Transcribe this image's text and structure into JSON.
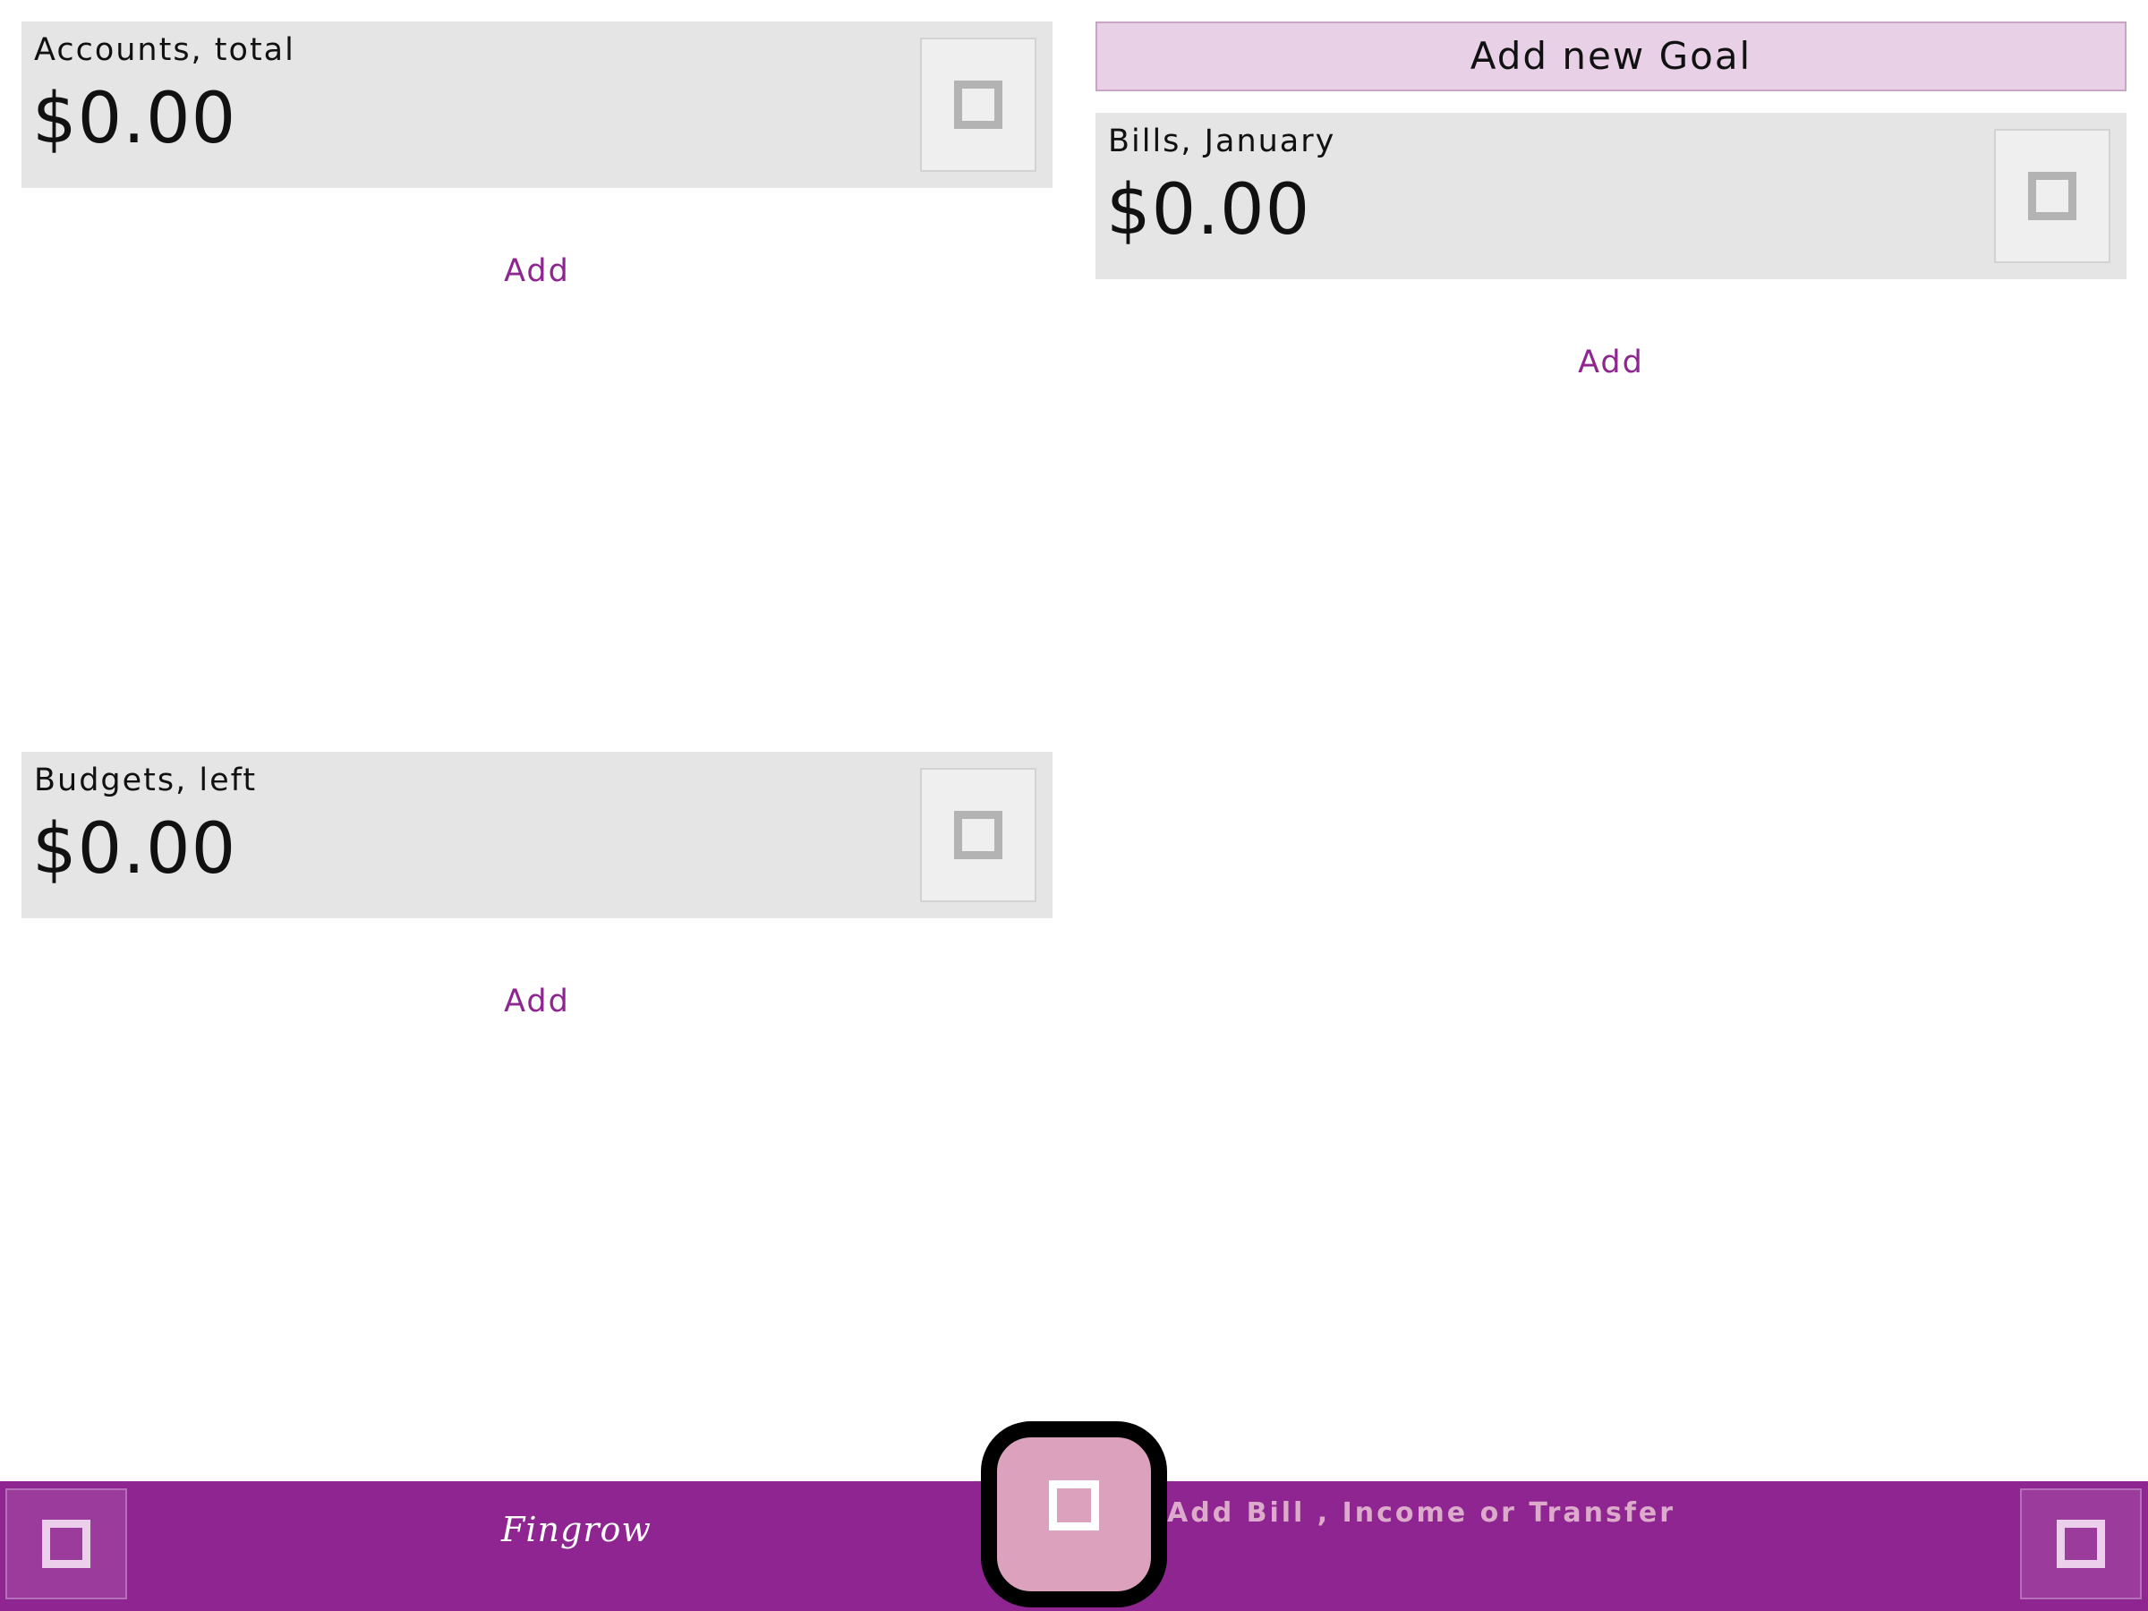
{
  "accounts": {
    "label": "Accounts, total",
    "amount": "$0.00",
    "action_icon": "square-icon",
    "add_label": "Add"
  },
  "budgets": {
    "label": "Budgets, left",
    "amount": "$0.00",
    "action_icon": "square-icon",
    "add_label": "Add"
  },
  "goals": {
    "add_button_label": "Add new Goal"
  },
  "bills": {
    "label": "Bills, January",
    "amount": "$0.00",
    "action_icon": "square-icon",
    "add_label": "Add"
  },
  "bottom_bar": {
    "left_icon": "square-icon",
    "logo_text": "Fingrow",
    "fab_icon": "square-icon",
    "hint_text": "Add Bill , Income or Transfer",
    "right_icon": "square-icon"
  },
  "colors": {
    "accent": "#8e2591",
    "card_bg": "#e5e5e5",
    "goal_button_bg": "#e8d1e6",
    "fab_bg": "#dca2bd",
    "hint_text": "#dcaacb"
  }
}
